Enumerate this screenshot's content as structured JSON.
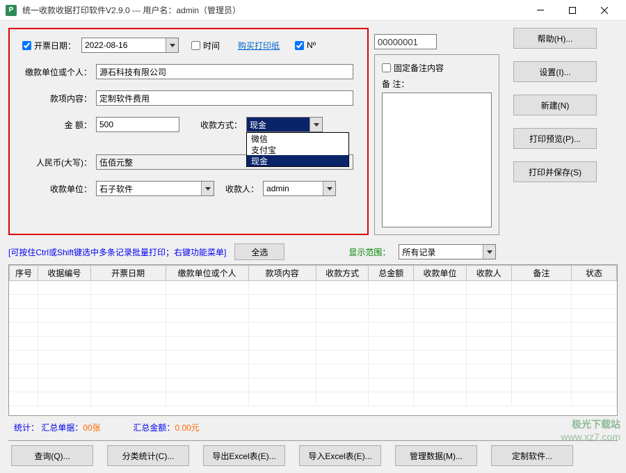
{
  "window": {
    "icon_letter": "P",
    "title": "统一收款收据打印软件V2.9.0 --- 用户名：admin（管理员）"
  },
  "form": {
    "date_label": "开票日期：",
    "date_value": "2022-08-16",
    "date_checked": true,
    "time_label": "时间",
    "time_checked": false,
    "buy_paper": "购买打印纸",
    "no_label": "Nº",
    "no_checked": true,
    "no_value": "00000001",
    "payer_label": "缴款单位或个人：",
    "payer_value": "源石科技有限公司",
    "item_label": "款项内容：",
    "item_value": "定制软件费用",
    "amount_label": "金      额：",
    "amount_value": "500",
    "pay_method_label": "收款方式：",
    "pay_method_value": "现金",
    "pay_method_options": [
      "微信",
      "支付宝",
      "现金"
    ],
    "rmb_label": "人民币(大写)：",
    "rmb_value": "伍佰元整",
    "payee_unit_label": "收款单位：",
    "payee_unit_value": "石子软件",
    "payee_label": "收款人：",
    "payee_value": "admin"
  },
  "note": {
    "fixed_label": "固定备注内容",
    "fixed_checked": false,
    "remark_label": "备  注："
  },
  "side_buttons": {
    "help": "帮助(H)...",
    "settings": "设置(I)...",
    "new": "新建(N)",
    "preview": "打印预览(P)...",
    "print_save": "打印并保存(S)"
  },
  "middle": {
    "hint": "[可按住Ctrl或Shift键选中多条记录批量打印；右键功能菜单]",
    "select_all": "全选",
    "scope_label": "显示范围：",
    "scope_value": "所有记录"
  },
  "table_headers": [
    "序号",
    "收据编号",
    "开票日期",
    "缴款单位或个人",
    "款项内容",
    "收款方式",
    "总金额",
    "收款单位",
    "收款人",
    "备注",
    "状态"
  ],
  "stats": {
    "prefix": "统计：",
    "count_label": "汇总单据：",
    "count_value": "00张",
    "amount_label": "汇总金额：",
    "amount_value": "0.00元"
  },
  "bottom_buttons": {
    "query": "查询(Q)...",
    "stat": "分类统计(C)...",
    "export": "导出Excel表(E)...",
    "import": "导入Excel表(E)...",
    "manage": "管理数据(M)...",
    "customize": "定制软件..."
  },
  "watermark": {
    "brand": "极光下载站",
    "url": "www.xz7.com"
  }
}
